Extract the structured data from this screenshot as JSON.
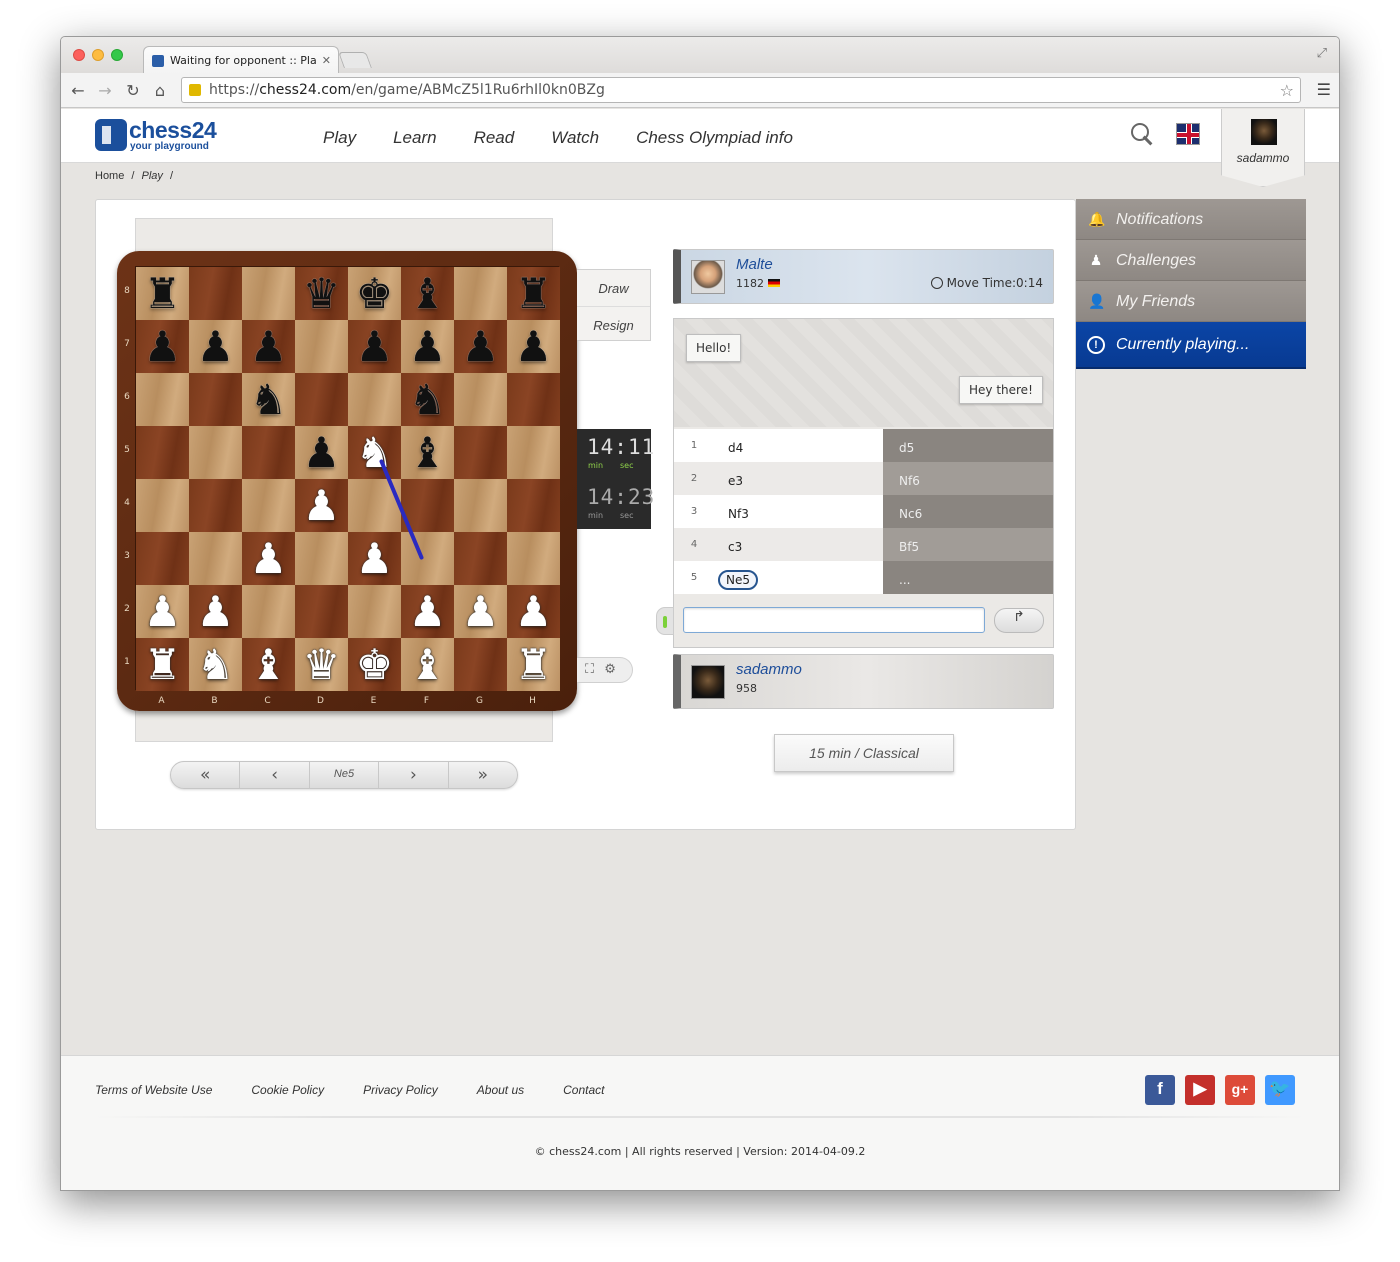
{
  "browser": {
    "tab_title": "Waiting for opponent :: Pla",
    "url_scheme": "https://",
    "url_host": "chess24.com",
    "url_path": "/en/game/ABMcZ5l1Ru6rhIl0kn0BZg"
  },
  "header": {
    "logo_text": "chess24",
    "logo_sub": "your playground",
    "nav": [
      "Play",
      "Learn",
      "Read",
      "Watch",
      "Chess Olympiad info"
    ],
    "username": "sadammo"
  },
  "breadcrumb": {
    "home": "Home",
    "play": "Play",
    "sep": "/"
  },
  "board": {
    "ranks": [
      "8",
      "7",
      "6",
      "5",
      "4",
      "3",
      "2",
      "1"
    ],
    "files": [
      "A",
      "B",
      "C",
      "D",
      "E",
      "F",
      "G",
      "H"
    ],
    "position": [
      [
        "br",
        "",
        "",
        "bq",
        "bk",
        "bb",
        "",
        "br"
      ],
      [
        "bp",
        "bp",
        "bp",
        "",
        "bp",
        "bp",
        "bp",
        "bp"
      ],
      [
        "",
        "",
        "bn",
        "",
        "",
        "bn",
        "",
        ""
      ],
      [
        "",
        "",
        "",
        "bp",
        "wn",
        "bb",
        "",
        ""
      ],
      [
        "",
        "",
        "",
        "wp",
        "",
        "",
        "",
        ""
      ],
      [
        "",
        "",
        "wp",
        "",
        "wp",
        "",
        "",
        ""
      ],
      [
        "wp",
        "wp",
        "",
        "",
        "",
        "wp",
        "wp",
        "wp"
      ],
      [
        "wr",
        "wn",
        "wb",
        "wq",
        "wk",
        "wb",
        "",
        "wr"
      ]
    ],
    "last_move_arrow": {
      "from": "f3",
      "to": "e5",
      "color": "#2a2ac0"
    }
  },
  "actions": {
    "draw": "Draw",
    "resign": "Resign"
  },
  "clocks": {
    "top": {
      "min": "14",
      "sec": "11",
      "min_label": "min",
      "sec_label": "sec"
    },
    "bottom": {
      "min": "14",
      "sec": "23",
      "min_label": "min",
      "sec_label": "sec"
    }
  },
  "move_nav": {
    "first": "«",
    "prev": "‹",
    "current": "Ne5",
    "next": "›",
    "last": "»"
  },
  "top_player": {
    "name": "Malte",
    "rating": "1182",
    "move_time": "Move Time:0:14"
  },
  "bottom_player": {
    "name": "sadammo",
    "rating": "958"
  },
  "chat": {
    "msg_left": "Hello!",
    "msg_right": "Hey there!",
    "input_placeholder": ""
  },
  "moves": [
    {
      "num": "1",
      "white": "d4",
      "black": "d5"
    },
    {
      "num": "2",
      "white": "e3",
      "black": "Nf6"
    },
    {
      "num": "3",
      "white": "Nf3",
      "black": "Nc6"
    },
    {
      "num": "4",
      "white": "c3",
      "black": "Bf5"
    },
    {
      "num": "5",
      "white": "Ne5",
      "black": "..."
    }
  ],
  "time_control": "15 min  /  Classical",
  "side_menu": [
    "Notifications",
    "Challenges",
    "My Friends",
    "Currently playing..."
  ],
  "footer": {
    "links": [
      "Terms of Website Use",
      "Cookie Policy",
      "Privacy Policy",
      "About us",
      "Contact"
    ],
    "copyright": "© chess24.com  |  All rights reserved  |  Version: 2014-04-09.2"
  },
  "colors": {
    "brand": "#1b4f9c",
    "active_menu": "#0b45a6",
    "board_dark": "#7a3a1b",
    "board_light": "#c9a275"
  }
}
